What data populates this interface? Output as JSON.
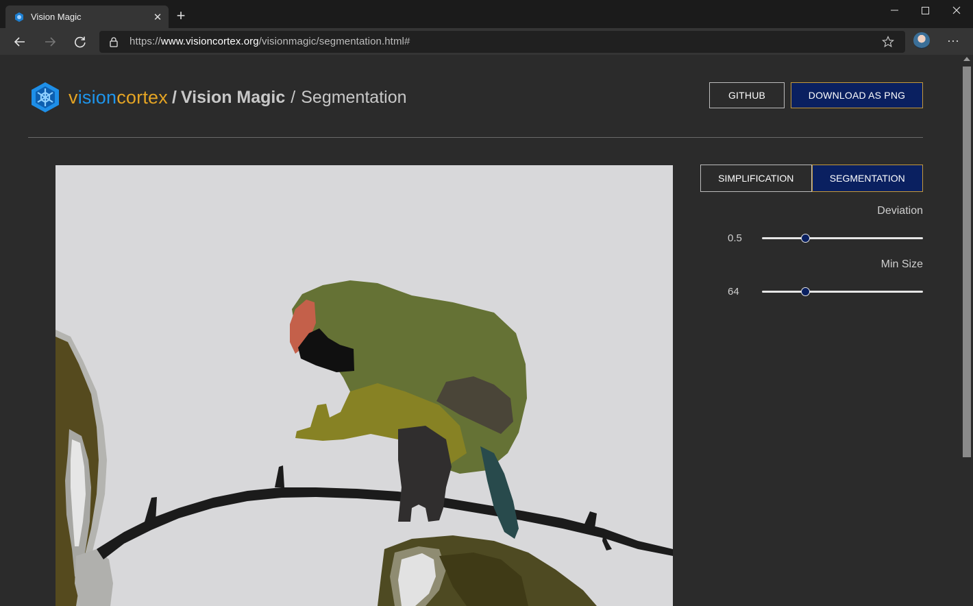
{
  "browser": {
    "tab_title": "Vision Magic",
    "url_scheme": "https://",
    "url_host": "www.visioncortex.org",
    "url_path": "/visionmagic/segmentation.html#"
  },
  "header": {
    "brand_parts": [
      "v",
      "ision",
      "cortex",
      ""
    ],
    "brand": "visioncortex",
    "separator": "/",
    "app_name": "Vision Magic",
    "page_name": "Segmentation",
    "github_label": "GITHUB",
    "download_label": "DOWNLOAD AS PNG"
  },
  "modes": {
    "simplification_label": "SIMPLIFICATION",
    "segmentation_label": "SEGMENTATION",
    "active": "segmentation"
  },
  "params": {
    "deviation_label": "Deviation",
    "deviation_value": "0.5",
    "deviation_fraction": 0.27,
    "min_size_label": "Min Size",
    "min_size_value": "64",
    "min_size_fraction": 0.27
  },
  "colors": {
    "accent_navy": "#0a2060",
    "accent_gold": "#c69a3a",
    "brand_blue": "#1e95ec",
    "brand_gold": "#e4a424"
  }
}
